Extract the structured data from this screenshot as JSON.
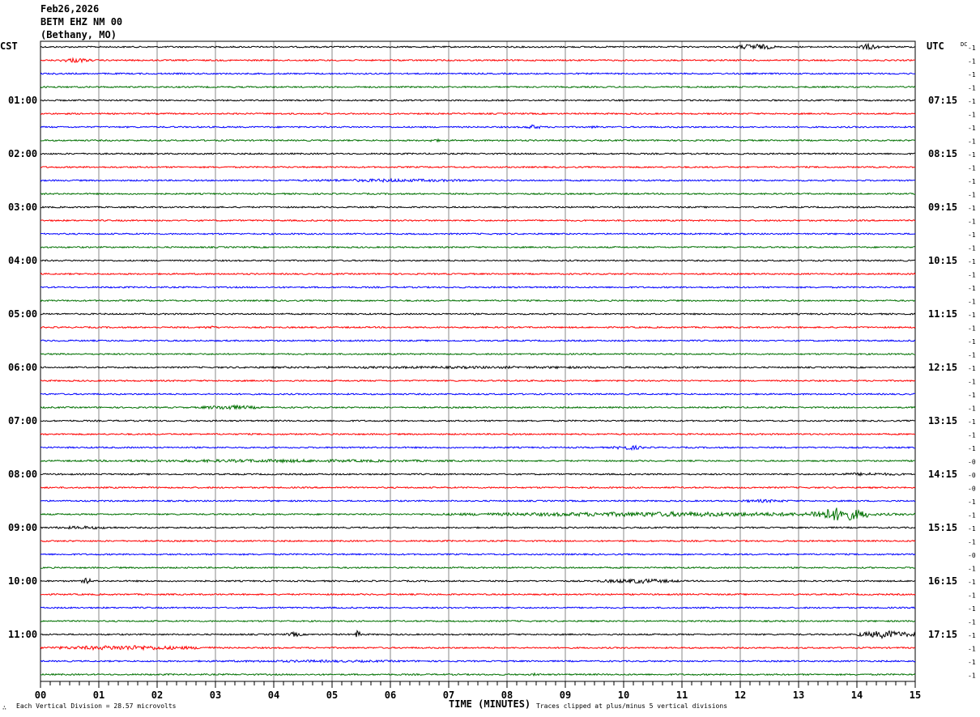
{
  "header": {
    "date": "Feb26,2026",
    "station": "BETM EHZ NM 00",
    "location": "(Bethany, MO)"
  },
  "left_tz": "CST",
  "right_tz": "UTC",
  "dc_label": "DC",
  "footer": {
    "division": "Each Vertical Division =   28.57 microvolts",
    "xlabel": "TIME (MINUTES)",
    "clip_note": "Traces clipped at plus/minus 5 vertical divisions",
    "logo": "∴"
  },
  "chart_data": {
    "type": "line",
    "title": "Feb26,2026 BETM EHZ NM 00 (Bethany, MO)",
    "xlabel": "TIME (MINUTES)",
    "xlim": [
      0,
      15
    ],
    "x_ticks": [
      "00",
      "01",
      "02",
      "03",
      "04",
      "05",
      "06",
      "07",
      "08",
      "09",
      "10",
      "11",
      "12",
      "13",
      "14",
      "15"
    ],
    "rows": 48,
    "minutes_per_row": 15,
    "colors": [
      "#000000",
      "#ff0000",
      "#0000ff",
      "#007000"
    ],
    "left_labels": {
      "4": "01:00",
      "8": "02:00",
      "12": "03:00",
      "16": "04:00",
      "20": "05:00",
      "24": "06:00",
      "28": "07:00",
      "32": "08:00",
      "36": "09:00",
      "40": "10:00",
      "44": "11:00"
    },
    "right_labels": {
      "4": "07:15",
      "8": "08:15",
      "12": "09:15",
      "16": "10:15",
      "20": "11:15",
      "24": "12:15",
      "28": "13:15",
      "32": "14:15",
      "36": "15:15",
      "40": "16:15",
      "44": "17:15"
    },
    "dc_offsets": [
      "-1",
      "-1",
      "-1",
      "-1",
      "-1",
      "-1",
      "-1",
      "-1",
      "-1",
      "-1",
      "-1",
      "-1",
      "-1",
      "-1",
      "-1",
      "-1",
      "-1",
      "-1",
      "-1",
      "-1",
      "-1",
      "-1",
      "-1",
      "-1",
      "-1",
      "-1",
      "-1",
      "-1",
      "-1",
      "-1",
      "-1",
      "-0",
      "-0",
      "-0",
      "-1",
      "-1",
      "-1",
      "-1",
      "-0",
      "-1",
      "-1",
      "-1",
      "-1",
      "-1",
      "-1",
      "-1",
      "-1",
      "-1"
    ],
    "events": [
      {
        "row": 0,
        "start": 11.9,
        "end": 12.6,
        "amp": 4
      },
      {
        "row": 0,
        "start": 14.0,
        "end": 14.4,
        "amp": 4
      },
      {
        "row": 1,
        "start": 0.3,
        "end": 0.9,
        "amp": 3
      },
      {
        "row": 6,
        "start": 8.3,
        "end": 8.6,
        "amp": 3
      },
      {
        "row": 6,
        "start": 9.4,
        "end": 9.6,
        "amp": 2
      },
      {
        "row": 7,
        "start": 6.6,
        "end": 6.9,
        "amp": 2
      },
      {
        "row": 10,
        "start": 4.0,
        "end": 8.0,
        "amp": 2
      },
      {
        "row": 21,
        "start": 2.7,
        "end": 3.1,
        "amp": 2
      },
      {
        "row": 24,
        "start": 0,
        "end": 15,
        "amp": 1.5
      },
      {
        "row": 27,
        "start": 2.7,
        "end": 3.8,
        "amp": 3
      },
      {
        "row": 30,
        "start": 9.8,
        "end": 10.4,
        "amp": 3
      },
      {
        "row": 31,
        "start": 0,
        "end": 8.0,
        "amp": 2
      },
      {
        "row": 32,
        "start": 13.3,
        "end": 15,
        "amp": 2
      },
      {
        "row": 34,
        "start": 11.8,
        "end": 13.0,
        "amp": 2
      },
      {
        "row": 35,
        "start": 6.5,
        "end": 15,
        "amp": 3
      },
      {
        "row": 35,
        "start": 13.2,
        "end": 14.2,
        "amp": 9
      },
      {
        "row": 36,
        "start": 0,
        "end": 1.5,
        "amp": 2
      },
      {
        "row": 40,
        "start": 0.7,
        "end": 0.9,
        "amp": 4
      },
      {
        "row": 40,
        "start": 9.5,
        "end": 11.0,
        "amp": 3
      },
      {
        "row": 44,
        "start": 4.2,
        "end": 4.5,
        "amp": 3
      },
      {
        "row": 44,
        "start": 5.4,
        "end": 5.5,
        "amp": 6
      },
      {
        "row": 44,
        "start": 14.0,
        "end": 15,
        "amp": 5
      },
      {
        "row": 45,
        "start": 0,
        "end": 3.0,
        "amp": 3
      },
      {
        "row": 46,
        "start": 1.5,
        "end": 8.0,
        "amp": 1.5
      },
      {
        "row": 47,
        "start": 8.4,
        "end": 8.6,
        "amp": 2
      }
    ]
  }
}
